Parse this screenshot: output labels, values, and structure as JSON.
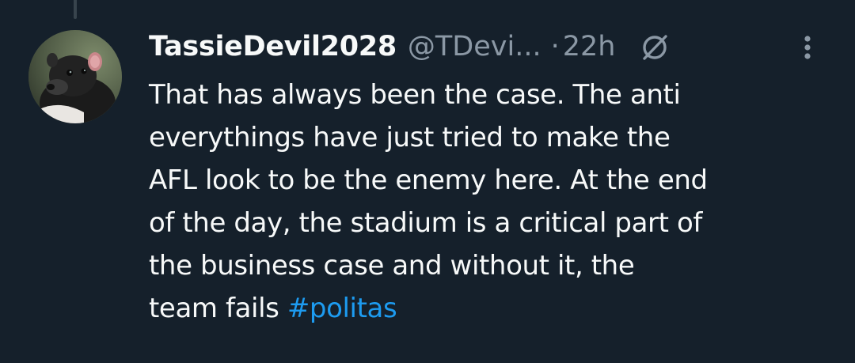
{
  "tweet": {
    "display_name": "TassieDevil2028",
    "handle": "@TDevi...",
    "separator": "·",
    "timestamp": "22h",
    "text_lines": [
      "That has always been the case. The anti",
      "everythings have just tried to make the",
      "AFL look to be the enemy here. At the end",
      "of the day, the stadium is a critical part of",
      "the business case and without it, the",
      "team fails "
    ],
    "hashtag": "#politas"
  },
  "icons": {
    "avatar": "tasmanian-devil-avatar",
    "badge": "slashed-circle-icon",
    "more": "more-vertical-icon"
  },
  "colors": {
    "background": "#15202b",
    "text": "#f7f9f9",
    "secondary_text": "#8b98a5",
    "link": "#1d9bf0"
  }
}
